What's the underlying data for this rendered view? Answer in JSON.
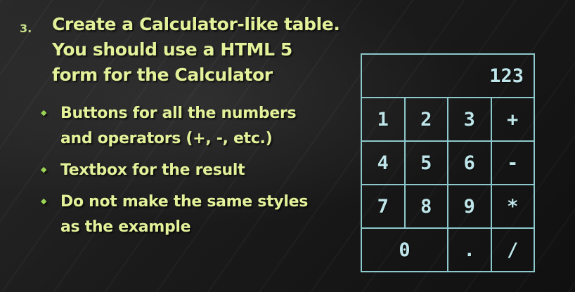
{
  "slide": {
    "item_number": "3.",
    "heading_lines": [
      "Create a Calculator-like table.",
      "You should use a HTML 5",
      "form for the Calculator"
    ],
    "bullets": [
      {
        "lines": [
          "Buttons for all the numbers",
          "and operators (+, -, etc.)"
        ]
      },
      {
        "lines": [
          "Textbox for the result"
        ]
      },
      {
        "lines": [
          "Do not make the same styles",
          "as the example"
        ]
      }
    ],
    "bullet_symbol": "◆"
  },
  "calculator": {
    "display": "123",
    "row1": [
      "1",
      "2",
      "3",
      "+"
    ],
    "row2": [
      "4",
      "5",
      "6",
      "-"
    ],
    "row3": [
      "7",
      "8",
      "9",
      "*"
    ],
    "row4": [
      "0",
      ".",
      "/"
    ]
  },
  "colors": {
    "heading": "#e3f29a",
    "bullet_marker": "#9bd454",
    "calc_border": "#8cc8cc",
    "calc_text": "#bfe6ea"
  }
}
